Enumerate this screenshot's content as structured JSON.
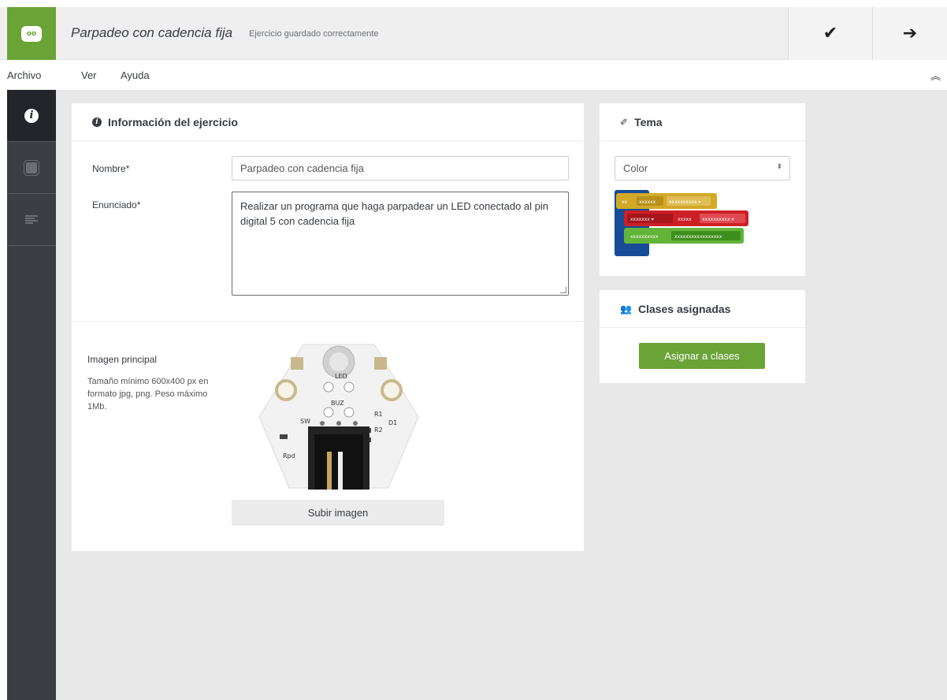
{
  "header": {
    "logo_text": "oo",
    "exercise_title": "Parpadeo con cadencia fija",
    "save_status": "Ejercicio guardado correctamente",
    "check_icon": "✔",
    "next_icon": "➔"
  },
  "menu": {
    "items": [
      "Archivo",
      "Ver",
      "Ayuda"
    ],
    "collapse_icon": "︽"
  },
  "sidebar": {
    "tabs": [
      "info",
      "hardware",
      "software"
    ],
    "info_glyph": "i"
  },
  "info_card": {
    "title": "Información del ejercicio",
    "name_label": "Nombre*",
    "name_value": "Parpadeo con cadencia fija",
    "statement_label": "Enunciado*",
    "statement_value": "Realizar un programa que haga parpadear un LED conectado al pin digital 5 con cadencia fija",
    "image_label": "Imagen principal",
    "image_help": "Tamaño mínimo 600x400 px en formato jpg, png. Peso máximo 1Mb.",
    "upload_button": "Subir imagen",
    "board_labels": {
      "led": "LED",
      "buz": "BUZ",
      "sw": "SW",
      "r1": "R1",
      "r2": "R2",
      "d1": "D1",
      "rpd": "Rpd"
    }
  },
  "theme_card": {
    "title": "Tema",
    "select_value": "Color",
    "select_arrow": "⬍",
    "preview": {
      "row1": [
        "xx",
        "xxxxxx",
        "xxxxxxxxxx ▾"
      ],
      "row2": [
        "xxxxxxx ▾",
        "xxxxx",
        "xxxxxxxxxx ▾"
      ],
      "row3": [
        "xxxxxxxxxx",
        "xxxxxxxxxxxxxxxxx"
      ]
    }
  },
  "classes_card": {
    "title": "Clases asignadas",
    "assign_button": "Asignar a clases"
  },
  "colors": {
    "accent": "#6aa336",
    "sidebar": "#3b3e45",
    "block_yellow": "#d3a928",
    "block_red": "#cc2027",
    "block_green": "#62b538",
    "block_blue": "#164b98"
  }
}
